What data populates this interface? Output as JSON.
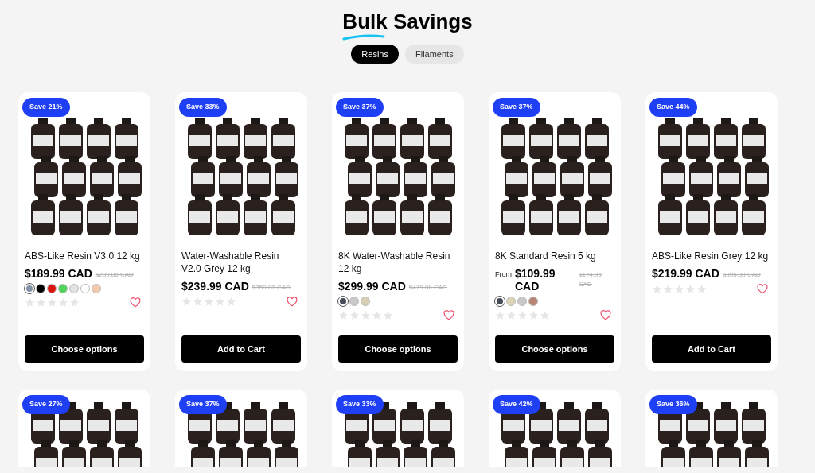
{
  "heading": {
    "title": "Bulk Savings"
  },
  "tabs": [
    {
      "label": "Resins",
      "selected": true
    },
    {
      "label": "Filaments",
      "selected": false
    }
  ],
  "products": [
    {
      "badge": "Save 21%",
      "title": "ABS-Like Resin V3.0 12 kg",
      "price": "$189.99 CAD",
      "compare_price": "$239.88 CAD",
      "swatches": [
        {
          "color": "#8391a8",
          "selected": true
        },
        {
          "color": "#000000",
          "selected": false
        },
        {
          "color": "#d9140f",
          "selected": false
        },
        {
          "color": "#4fd35a",
          "selected": false
        },
        {
          "color": "#e2e2e2",
          "selected": false
        },
        {
          "color": "#ffffff",
          "selected": false
        },
        {
          "color": "#f3c9ad",
          "selected": false
        }
      ],
      "stars": 0,
      "button": "Choose options"
    },
    {
      "badge": "Save 33%",
      "title": "Water-Washable Resin V2.0 Grey 12 kg",
      "price": "$239.99 CAD",
      "compare_price": "$359.88 CAD",
      "stars": 0,
      "button": "Add to Cart"
    },
    {
      "badge": "Save 37%",
      "title": "8K Water-Washable Resin 12 kg",
      "price": "$299.99 CAD",
      "compare_price": "$479.88 CAD",
      "swatches": [
        {
          "color": "#454c57",
          "selected": true
        },
        {
          "color": "#c9c9c9",
          "selected": false
        },
        {
          "color": "#d8d0b4",
          "selected": false
        }
      ],
      "stars": 0,
      "button": "Choose options"
    },
    {
      "badge": "Save 37%",
      "title": "8K Standard Resin 5 kg",
      "price_prefix": "From",
      "price": "$109.99 CAD",
      "compare_price": "$174.95 CAD",
      "swatches": [
        {
          "color": "#454c57",
          "selected": true
        },
        {
          "color": "#ddd4b8",
          "selected": false
        },
        {
          "color": "#c9c9c9",
          "selected": false
        },
        {
          "color": "#b98474",
          "selected": false
        }
      ],
      "stars": 0,
      "button": "Choose options"
    },
    {
      "badge": "Save 44%",
      "title": "ABS-Like Resin Grey 12 kg",
      "price": "$219.99 CAD",
      "compare_price": "$395.88 CAD",
      "stars": 0,
      "button": "Add to Cart"
    },
    {
      "badge": "Save 27%"
    },
    {
      "badge": "Save 37%"
    },
    {
      "badge": "Save 33%"
    },
    {
      "badge": "Save 42%"
    },
    {
      "badge": "Save 36%"
    }
  ]
}
